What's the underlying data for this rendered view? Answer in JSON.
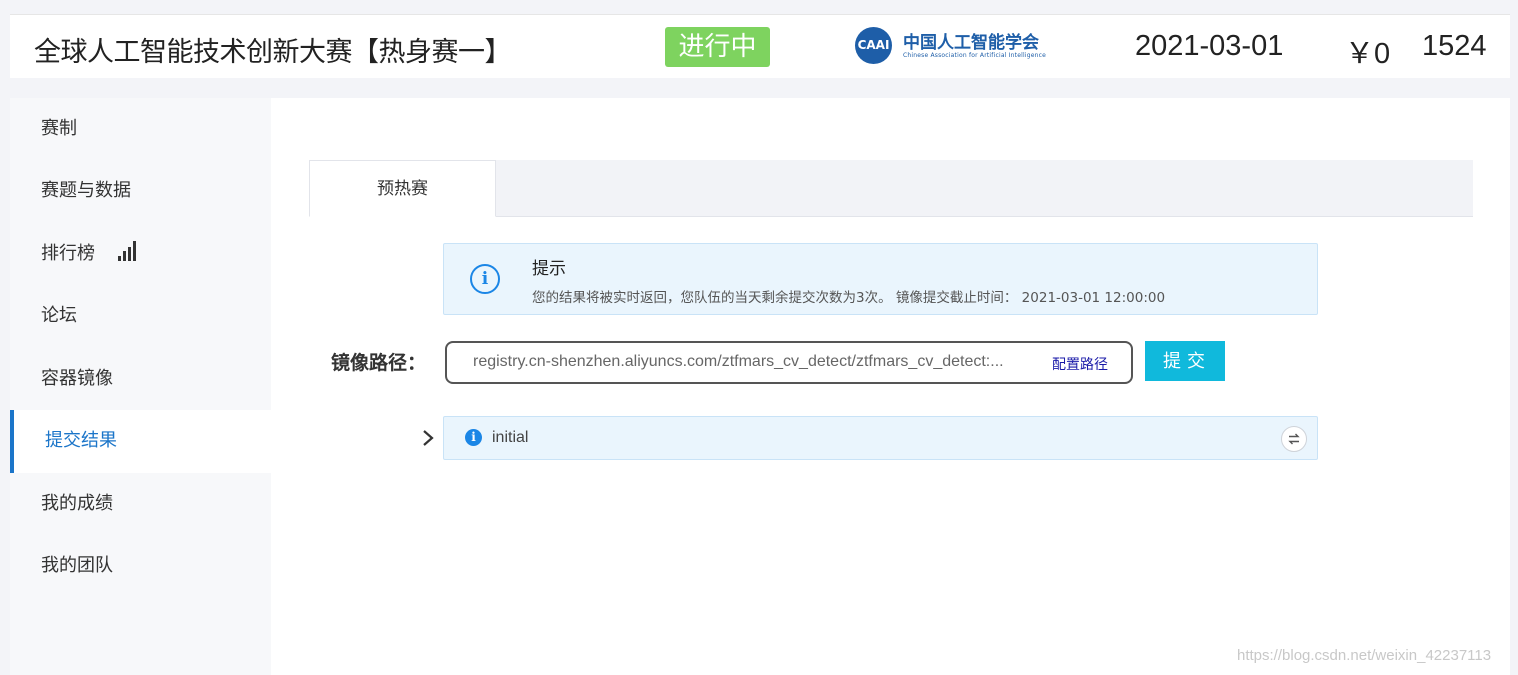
{
  "header": {
    "title": "全球人工智能技术创新大赛【热身赛一】",
    "status": "进行中",
    "logo": {
      "icon": "caai-logo",
      "mark_text": "CAAI",
      "name_cn": "中国人工智能学会",
      "name_en": "Chinese Association for Artificial Intelligence"
    },
    "date": "2021-03-01",
    "prize": "￥0",
    "teams": "1524"
  },
  "sidebar": {
    "items": [
      {
        "label": "赛制"
      },
      {
        "label": "赛题与数据"
      },
      {
        "label": "排行榜",
        "icon": "bar-chart-icon"
      },
      {
        "label": "论坛"
      },
      {
        "label": "容器镜像"
      },
      {
        "label": "提交结果",
        "active": true
      },
      {
        "label": "我的成绩"
      },
      {
        "label": "我的团队"
      }
    ]
  },
  "main": {
    "tabs": [
      {
        "label": "预热赛",
        "active": true
      }
    ],
    "tip": {
      "icon": "info-circle-icon",
      "title": "提示",
      "message": "您的结果将被实时返回，您队伍的当天剩余提交次数为3次。 镜像提交截止时间： 2021-03-01 12:00:00"
    },
    "image_path": {
      "label": "镜像路径：",
      "value": "registry.cn-shenzhen.aliyuncs.com/ztfmars_cv_detect/ztfmars_cv_detect:...",
      "config_link": "配置路径"
    },
    "submit_label": "提交",
    "result": {
      "icon": "info-filled-icon",
      "status": "initial",
      "refresh_icon": "refresh-icon",
      "expand_icon": "chevron-right-icon"
    }
  },
  "watermark": "https://blog.csdn.net/weixin_42237113",
  "colors": {
    "accent": "#1b75c9",
    "status_green": "#7ed35f",
    "submit_cyan": "#10b9dc",
    "info_blue": "#1b86e6"
  }
}
